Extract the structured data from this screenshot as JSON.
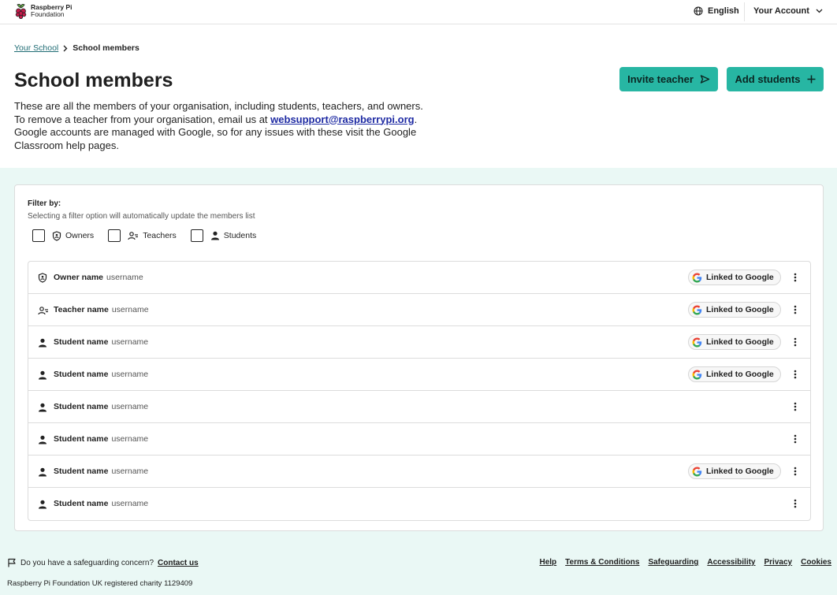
{
  "header": {
    "logo_line1": "Raspberry Pi",
    "logo_line2": "Foundation",
    "language": "English",
    "account": "Your Account"
  },
  "breadcrumb": {
    "parent": "Your School",
    "current": "School members"
  },
  "page": {
    "title": "School members",
    "intro_line1": "These are all the members of your organisation, including students, teachers, and owners.",
    "intro_line2_prefix": "To remove a teacher from your organisation, email us at ",
    "intro_email": "websupport@raspberrypi.org",
    "intro_line2_suffix": ".",
    "intro_line3": "Google accounts are managed with Google, so for any issues with these visit the Google Classroom help pages."
  },
  "actions": {
    "invite_label": "Invite teacher",
    "add_label": "Add students"
  },
  "filters": {
    "title": "Filter by:",
    "help": "Selecting a filter option will automatically update the members list",
    "options": [
      {
        "label": "Owners",
        "icon": "shield-icon",
        "checked": false
      },
      {
        "label": "Teachers",
        "icon": "teacher-icon",
        "checked": false
      },
      {
        "label": "Students",
        "icon": "person-icon",
        "checked": false
      }
    ]
  },
  "google_badge_label": "Linked to Google",
  "members": [
    {
      "role": "owner",
      "icon": "shield-icon",
      "name": "Owner name",
      "username": "username",
      "google": true
    },
    {
      "role": "teacher",
      "icon": "teacher-icon",
      "name": "Teacher name",
      "username": "username",
      "google": true
    },
    {
      "role": "student",
      "icon": "person-icon",
      "name": "Student name",
      "username": "username",
      "google": true
    },
    {
      "role": "student",
      "icon": "person-icon",
      "name": "Student name",
      "username": "username",
      "google": true
    },
    {
      "role": "student",
      "icon": "person-icon",
      "name": "Student name",
      "username": "username",
      "google": false
    },
    {
      "role": "student",
      "icon": "person-icon",
      "name": "Student name",
      "username": "username",
      "google": false
    },
    {
      "role": "student",
      "icon": "person-icon",
      "name": "Student name",
      "username": "username",
      "google": true
    },
    {
      "role": "student",
      "icon": "person-icon",
      "name": "Student name",
      "username": "username",
      "google": false
    }
  ],
  "footer": {
    "safeguard_text": "Do you have a safeguarding concern?",
    "safeguard_link": "Contact us",
    "links": [
      "Help",
      "Terms & Conditions",
      "Safeguarding",
      "Accessibility",
      "Privacy",
      "Cookies"
    ],
    "charity": "Raspberry Pi Foundation UK registered charity 1129409"
  },
  "colors": {
    "accent": "#27b6a3",
    "content_bg": "#eaf8f5",
    "link": "#1e2aa3"
  }
}
